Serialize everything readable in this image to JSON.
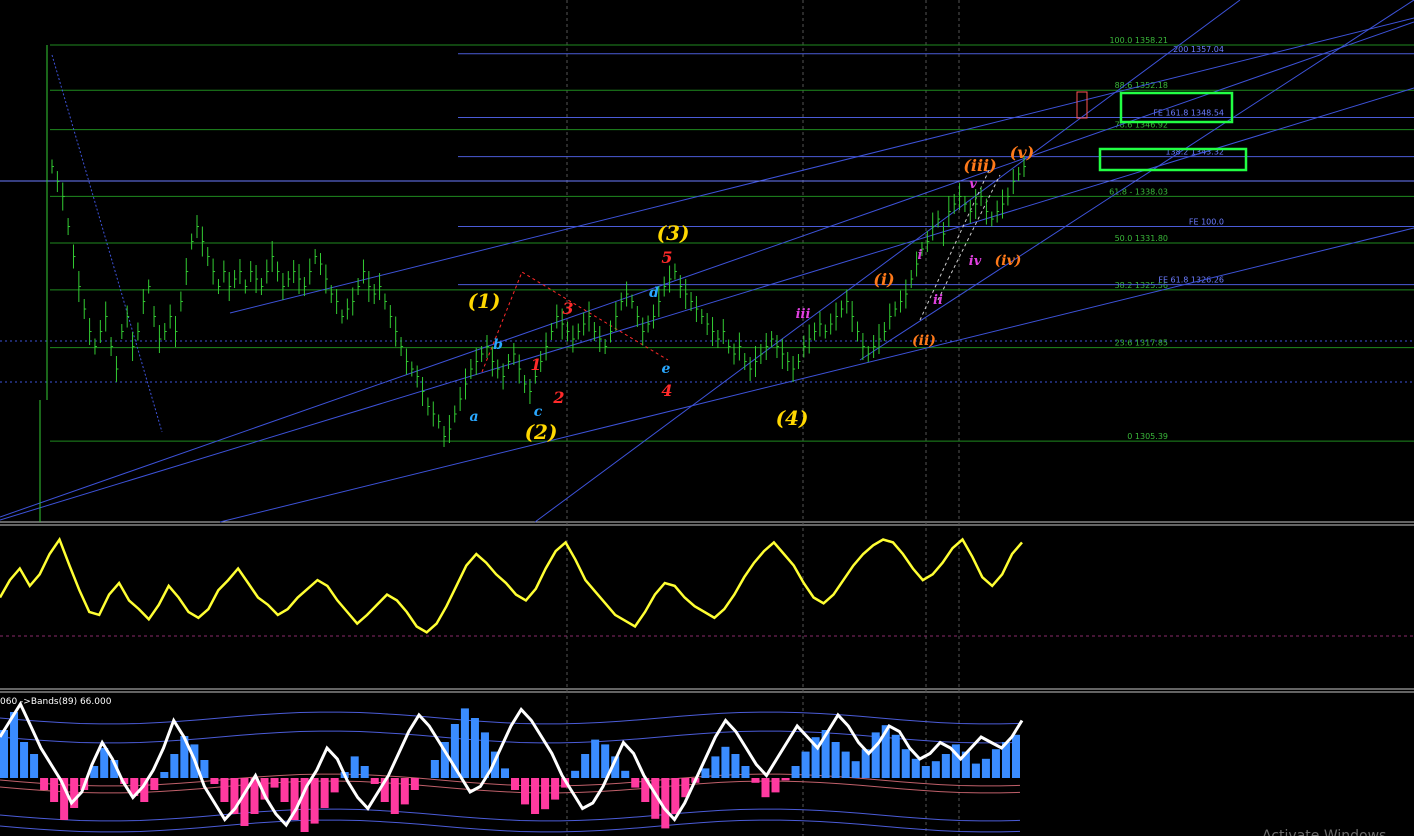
{
  "chart_data": {
    "type": "line",
    "title": "",
    "price_scale": {
      "min": 1300,
      "max": 1362
    },
    "fib_retracements": [
      {
        "label": "100.0 1358.21",
        "value": 1358.21
      },
      {
        "label": "88.6 1352.18",
        "value": 1352.18
      },
      {
        "label": "78.6 1346.92",
        "value": 1346.92
      },
      {
        "label": "61.8 - 1338.03",
        "value": 1338.03
      },
      {
        "label": "50.0 1331.80",
        "value": 1331.8
      },
      {
        "label": "38.2 1325.56",
        "value": 1325.56
      },
      {
        "label": "23.6 1317.85",
        "value": 1317.85
      },
      {
        "label": "0 1305.39",
        "value": 1305.39
      }
    ],
    "fib_extensions": [
      {
        "label": "200 1357.04",
        "value": 1357.04
      },
      {
        "label": "FE 161.8 1348.54",
        "value": 1348.54
      },
      {
        "label": "138.2 1343.32",
        "value": 1343.32
      },
      {
        "label": "FE 100.0",
        "value": 1334.0
      },
      {
        "label": "FE 61.8 1326.26",
        "value": 1326.26
      }
    ],
    "wave_labels": [
      {
        "text": "(1)",
        "color": "#ffd700"
      },
      {
        "text": "(2)",
        "color": "#ffd700"
      },
      {
        "text": "(3)",
        "color": "#ffd700"
      },
      {
        "text": "(4)",
        "color": "#ffd700"
      },
      {
        "text": "5",
        "color": "#ff2a2a"
      },
      {
        "text": "3",
        "color": "#ff2a2a"
      },
      {
        "text": "1",
        "color": "#ff2a2a"
      },
      {
        "text": "2",
        "color": "#ff2a2a"
      },
      {
        "text": "4",
        "color": "#ff2a2a"
      },
      {
        "text": "(i)",
        "color": "#ff7a1a"
      },
      {
        "text": "(ii)",
        "color": "#ff7a1a"
      },
      {
        "text": "(iii)",
        "color": "#ff7a1a"
      },
      {
        "text": "(iv)",
        "color": "#ff7a1a"
      },
      {
        "text": "(v)",
        "color": "#ff7a1a"
      },
      {
        "text": "a",
        "color": "#2aa8ff"
      },
      {
        "text": "b",
        "color": "#2aa8ff"
      },
      {
        "text": "c",
        "color": "#2aa8ff"
      },
      {
        "text": "d",
        "color": "#2aa8ff"
      },
      {
        "text": "e",
        "color": "#2aa8ff"
      },
      {
        "text": "i",
        "color": "#e040e0"
      },
      {
        "text": "ii",
        "color": "#e040e0"
      },
      {
        "text": "iii",
        "color": "#e040e0"
      },
      {
        "text": "iv",
        "color": "#e040e0"
      },
      {
        "text": "v",
        "color": "#e040e0"
      }
    ],
    "price_bars": [
      1342,
      1340,
      1338,
      1334,
      1330,
      1326,
      1323,
      1320,
      1318,
      1320,
      1322,
      1318,
      1315,
      1320,
      1322,
      1318,
      1320,
      1324,
      1326,
      1322,
      1319,
      1320,
      1322,
      1320,
      1324,
      1328,
      1332,
      1334,
      1332,
      1330,
      1328,
      1326,
      1328,
      1326,
      1327,
      1328,
      1326,
      1328,
      1327,
      1326,
      1328,
      1330,
      1328,
      1326,
      1327,
      1328,
      1327,
      1326,
      1328,
      1330,
      1329,
      1327,
      1325,
      1324,
      1322,
      1323,
      1324,
      1326,
      1328,
      1326,
      1325,
      1326,
      1324,
      1322,
      1320,
      1318,
      1316,
      1315,
      1314,
      1312,
      1310,
      1309,
      1308,
      1306,
      1307,
      1309,
      1311,
      1313,
      1315,
      1316,
      1317,
      1318,
      1316,
      1315,
      1314,
      1316,
      1317,
      1315,
      1313,
      1312,
      1314,
      1316,
      1318,
      1320,
      1322,
      1321,
      1320,
      1319,
      1320,
      1321,
      1322,
      1320,
      1319,
      1318,
      1320,
      1322,
      1324,
      1325,
      1324,
      1322,
      1320,
      1321,
      1322,
      1324,
      1326,
      1327,
      1328,
      1326,
      1325,
      1324,
      1323,
      1322,
      1321,
      1320,
      1319,
      1320,
      1318,
      1317,
      1318,
      1316,
      1315,
      1316,
      1317,
      1318,
      1319,
      1318,
      1317,
      1316,
      1315,
      1316,
      1318,
      1319,
      1320,
      1321,
      1320,
      1321,
      1322,
      1323,
      1324,
      1322,
      1320,
      1318,
      1317,
      1318,
      1319,
      1320,
      1322,
      1323,
      1324,
      1325,
      1327,
      1329,
      1331,
      1332,
      1334,
      1335,
      1333,
      1336,
      1337,
      1338,
      1337,
      1336,
      1337,
      1338,
      1336,
      1335,
      1336,
      1337,
      1338,
      1340,
      1341,
      1342
    ],
    "oscillator_1": {
      "color": "#ffff33",
      "values": [
        50,
        62,
        70,
        58,
        66,
        80,
        90,
        72,
        55,
        40,
        38,
        52,
        60,
        48,
        42,
        35,
        45,
        58,
        50,
        40,
        36,
        42,
        55,
        62,
        70,
        60,
        50,
        45,
        38,
        42,
        50,
        56,
        62,
        58,
        48,
        40,
        32,
        38,
        45,
        52,
        48,
        40,
        30,
        26,
        32,
        44,
        58,
        72,
        80,
        74,
        66,
        60,
        52,
        48,
        56,
        70,
        82,
        88,
        76,
        62,
        54,
        46,
        38,
        34,
        30,
        40,
        52,
        60,
        58,
        50,
        44,
        40,
        36,
        42,
        52,
        64,
        74,
        82,
        88,
        80,
        72,
        60,
        50,
        46,
        52,
        62,
        72,
        80,
        86,
        90,
        88,
        80,
        70,
        62,
        66,
        74,
        84,
        90,
        78,
        64,
        58,
        66,
        80,
        88
      ]
    },
    "oscillator_2": {
      "line_color": "#ffffff",
      "histogram_pos": "#3a8cff",
      "histogram_neg": "#ff3aa0",
      "bands_label": "060  ->Bands(89) 66.000",
      "histogram": [
        40,
        55,
        30,
        20,
        -10,
        -20,
        -35,
        -25,
        -10,
        10,
        25,
        15,
        -5,
        -15,
        -20,
        -10,
        5,
        20,
        35,
        28,
        15,
        -5,
        -20,
        -30,
        -40,
        -30,
        -18,
        -8,
        -20,
        -35,
        -45,
        -38,
        -25,
        -12,
        5,
        18,
        10,
        -5,
        -20,
        -30,
        -22,
        -10,
        0,
        15,
        30,
        45,
        58,
        50,
        38,
        22,
        8,
        -10,
        -22,
        -30,
        -26,
        -18,
        -8,
        6,
        20,
        32,
        28,
        18,
        6,
        -8,
        -20,
        -34,
        -42,
        -30,
        -16,
        -4,
        8,
        18,
        26,
        20,
        10,
        -4,
        -16,
        -12,
        -2,
        10,
        22,
        34,
        40,
        30,
        22,
        14,
        24,
        38,
        44,
        36,
        24,
        16,
        10,
        14,
        20,
        28,
        22,
        12,
        16,
        24,
        30,
        36
      ],
      "line": [
        30,
        45,
        60,
        40,
        20,
        5,
        -10,
        -30,
        -20,
        5,
        25,
        10,
        -10,
        -25,
        -15,
        0,
        20,
        45,
        30,
        10,
        -15,
        -30,
        -45,
        -35,
        -20,
        -5,
        -25,
        -40,
        -50,
        -35,
        -15,
        0,
        20,
        10,
        -10,
        -25,
        -35,
        -20,
        -5,
        15,
        35,
        50,
        40,
        25,
        10,
        -5,
        -20,
        -15,
        0,
        20,
        40,
        55,
        45,
        30,
        15,
        -5,
        -20,
        -35,
        -30,
        -15,
        5,
        25,
        15,
        -5,
        -20,
        -35,
        -45,
        -30,
        -10,
        10,
        30,
        45,
        35,
        20,
        5,
        -5,
        10,
        25,
        40,
        30,
        20,
        35,
        50,
        40,
        25,
        15,
        25,
        40,
        35,
        20,
        10,
        15,
        25,
        20,
        10,
        20,
        30,
        25,
        20,
        30,
        45
      ]
    }
  },
  "watermark": "Activate Windows"
}
